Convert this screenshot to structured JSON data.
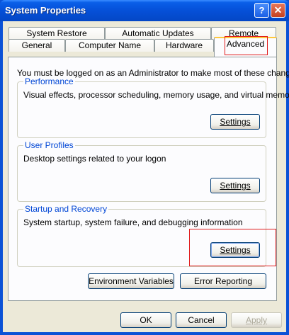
{
  "window": {
    "title": "System Properties",
    "help_glyph": "?",
    "close_glyph": "✕"
  },
  "tabs_top": [
    "System Restore",
    "Automatic Updates",
    "Remote"
  ],
  "tabs_bottom": [
    "General",
    "Computer Name",
    "Hardware",
    "Advanced"
  ],
  "active_tab": "Advanced",
  "intro": "You must be logged on as an Administrator to make most of these changes.",
  "performance": {
    "label": "Performance",
    "description": "Visual effects, processor scheduling, memory usage, and virtual memory",
    "button": "Settings"
  },
  "user_profiles": {
    "label": "User Profiles",
    "description": "Desktop settings related to your logon",
    "button": "Settings"
  },
  "startup_recovery": {
    "label": "Startup and Recovery",
    "description": "System startup, system failure, and debugging information",
    "button": "Settings"
  },
  "buttons": {
    "env_vars": "Environment Variables",
    "error_reporting": "Error Reporting",
    "ok": "OK",
    "cancel": "Cancel",
    "apply": "Apply"
  },
  "colors": {
    "titlebar": "#0550d8",
    "client": "#ece9d8",
    "group_label": "#0046d5",
    "highlight_box": "#e01b1b",
    "active_tab_accent": "#ffc83c"
  }
}
